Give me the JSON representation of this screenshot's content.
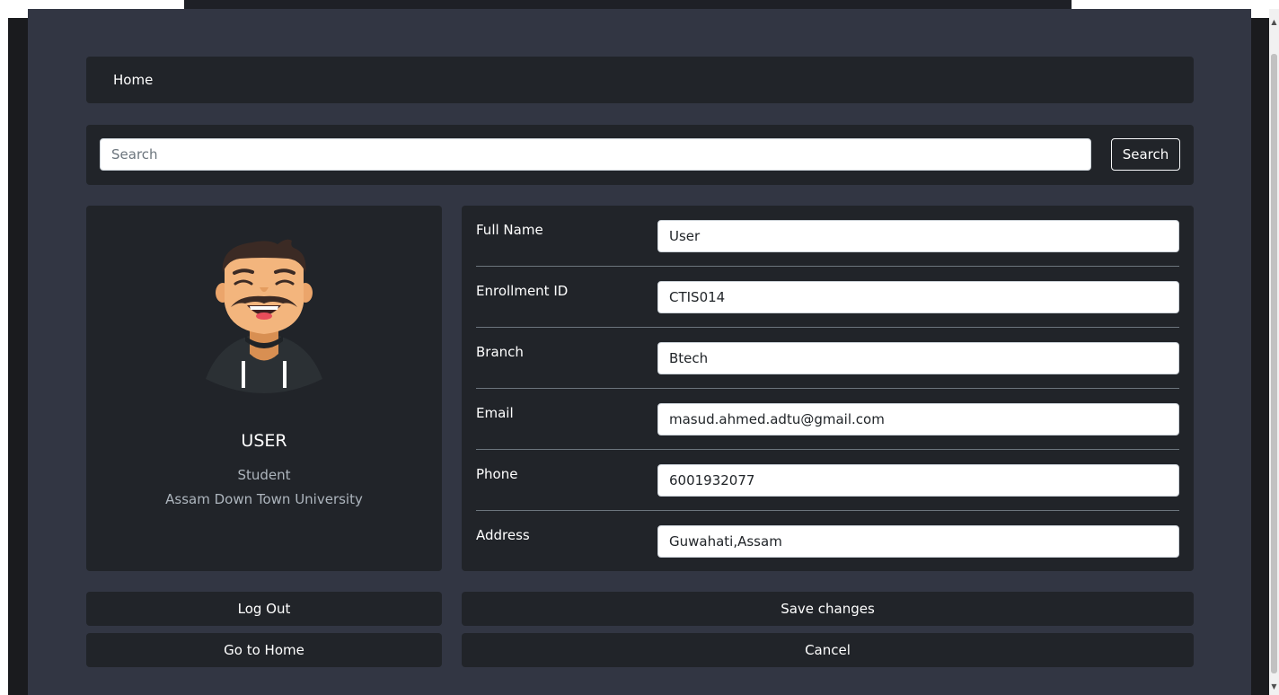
{
  "nav": {
    "home_label": "Home"
  },
  "search": {
    "placeholder": "Search",
    "button_label": "Search"
  },
  "profile": {
    "avatar_icon": "user-avatar-illustration",
    "name": "USER",
    "role": "Student",
    "organization": "Assam Down Town University"
  },
  "form": {
    "fields": [
      {
        "label": "Full Name",
        "value": "User"
      },
      {
        "label": "Enrollment ID",
        "value": "CTIS014"
      },
      {
        "label": "Branch",
        "value": "Btech"
      },
      {
        "label": "Email",
        "value": "masud.ahmed.adtu@gmail.com"
      },
      {
        "label": "Phone",
        "value": "6001932077"
      },
      {
        "label": "Address",
        "value": "Guwahati,Assam"
      }
    ]
  },
  "actions": {
    "logout_label": "Log Out",
    "go_home_label": "Go to Home",
    "save_label": "Save changes",
    "cancel_label": "Cancel"
  },
  "colors": {
    "page_bg": "#323643",
    "panel_bg": "#212429",
    "text": "#ffffff",
    "muted_text": "#adb5bd"
  }
}
